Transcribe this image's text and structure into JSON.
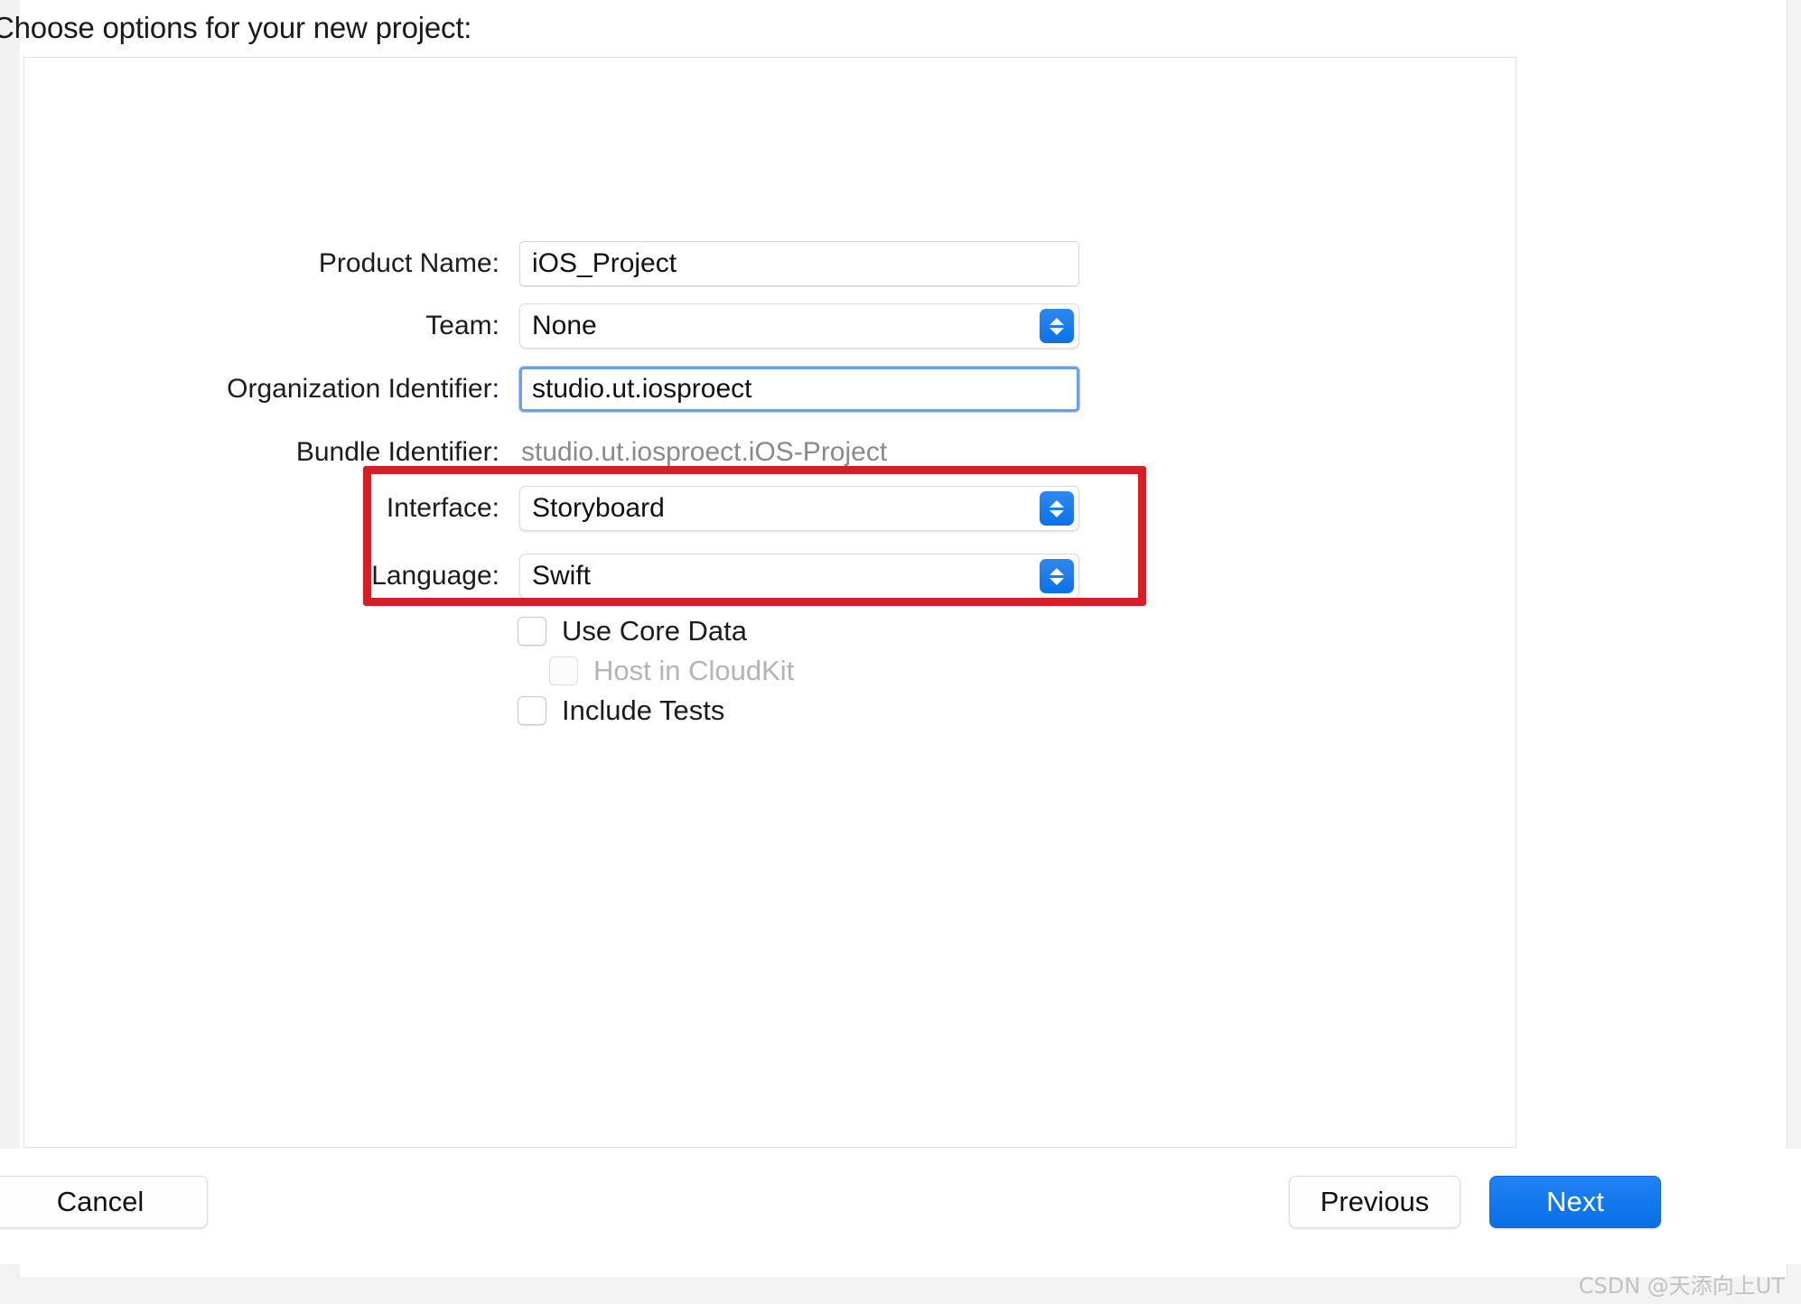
{
  "dialog": {
    "title": "Choose options for your new project:"
  },
  "form": {
    "rows": [
      {
        "label": "Product Name:",
        "value": "iOS_Project",
        "kind": "text"
      },
      {
        "label": "Team:",
        "value": "None",
        "kind": "popup"
      },
      {
        "label": "Organization Identifier:",
        "value": "studio.ut.iosproect",
        "kind": "text-focused"
      },
      {
        "label": "Bundle Identifier:",
        "value": "studio.ut.iosproect.iOS-Project",
        "kind": "static"
      },
      {
        "label": "Interface:",
        "value": "Storyboard",
        "kind": "popup"
      },
      {
        "label": "Language:",
        "value": "Swift",
        "kind": "popup"
      }
    ]
  },
  "checkboxes": [
    {
      "label": "Use Core Data",
      "checked": false,
      "disabled": false
    },
    {
      "label": "Host in CloudKit",
      "checked": false,
      "disabled": true
    },
    {
      "label": "Include Tests",
      "checked": false,
      "disabled": false
    }
  ],
  "footer": {
    "cancel_label": "Cancel",
    "previous_label": "Previous",
    "next_label": "Next"
  },
  "annotation": {
    "highlight_color": "#d31f26"
  },
  "watermark": {
    "text": "CSDN @天添向上UT"
  },
  "colors": {
    "accent_blue": "#0a72e8",
    "focus_ring": "#6d9eeb",
    "muted_text": "#8a8a8a"
  }
}
